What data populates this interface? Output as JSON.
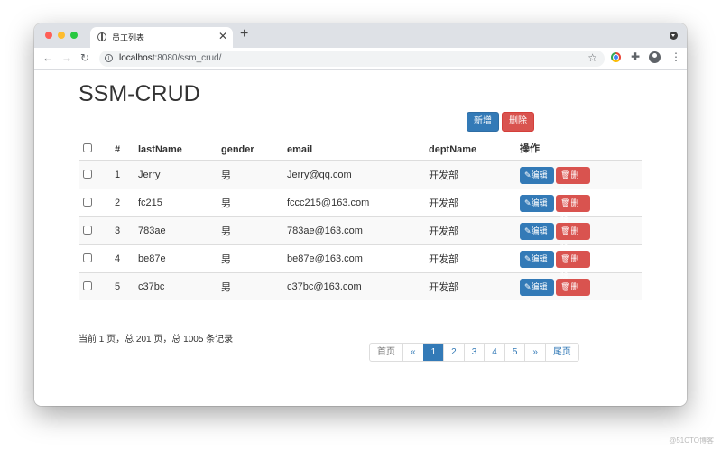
{
  "browser": {
    "tab_title": "员工列表",
    "tab_close": "✕",
    "new_tab": "+",
    "url_host": "localhost",
    "url_path": ":8080/ssm_crud/"
  },
  "page": {
    "title": "SSM-CRUD",
    "add_label": "新增",
    "delete_label": "删除"
  },
  "table": {
    "headers": [
      "#",
      "lastName",
      "gender",
      "email",
      "deptName",
      "操作"
    ],
    "rows": [
      {
        "id": "1",
        "lastName": "Jerry",
        "gender": "男",
        "email": "Jerry@qq.com",
        "dept": "开发部"
      },
      {
        "id": "2",
        "lastName": "fc215",
        "gender": "男",
        "email": "fccc215@163.com",
        "dept": "开发部"
      },
      {
        "id": "3",
        "lastName": "783ae",
        "gender": "男",
        "email": "783ae@163.com",
        "dept": "开发部"
      },
      {
        "id": "4",
        "lastName": "be87e",
        "gender": "男",
        "email": "be87e@163.com",
        "dept": "开发部"
      },
      {
        "id": "5",
        "lastName": "c37bc",
        "gender": "男",
        "email": "c37bc@163.com",
        "dept": "开发部"
      }
    ],
    "edit_label": "编辑",
    "delete_label": "删除"
  },
  "summary": "当前 1 页，总 201 页，总 1005 条记录",
  "pagination": [
    "首页",
    "«",
    "1",
    "2",
    "3",
    "4",
    "5",
    "»",
    "尾页"
  ],
  "pagination_active": "1",
  "watermark": "@51CTO博客",
  "colors": {
    "primary": "#337ab7",
    "danger": "#d9534f"
  }
}
